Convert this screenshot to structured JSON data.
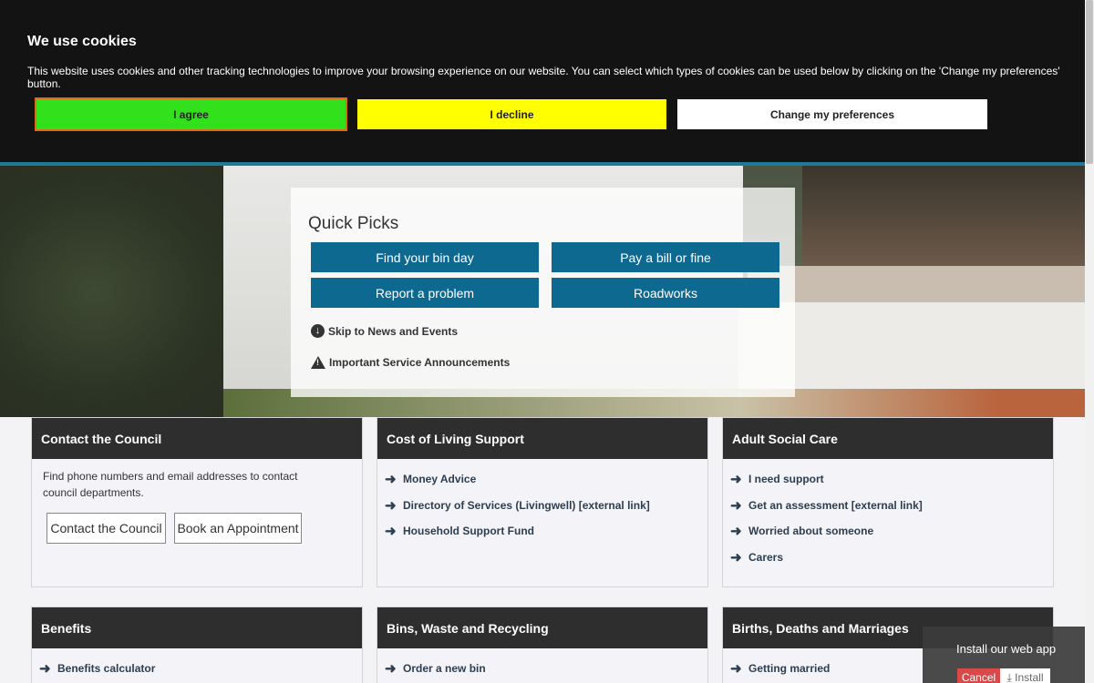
{
  "cookie": {
    "title": "We use cookies",
    "text": "This website uses cookies and other tracking technologies to improve your browsing experience on our website. You can select which types of cookies can be used below by clicking on the 'Change my preferences' button.",
    "agree": "I agree",
    "decline": "I decline",
    "prefs": "Change my preferences"
  },
  "quick_picks": {
    "title": "Quick Picks",
    "buttons": [
      "Find your bin day",
      "Pay a bill or fine",
      "Report a problem",
      "Roadworks"
    ],
    "skip_link": "Skip to News and Events",
    "announce_link": "Important Service Announcements"
  },
  "cards": [
    {
      "title": "Contact the Council",
      "text": "Find phone numbers and email addresses to contact council departments.",
      "buttons": [
        "Contact the Council",
        "Book an Appointment"
      ]
    },
    {
      "title": "Cost of Living Support",
      "links": [
        "Money Advice",
        "Directory of Services (Livingwell) [external link]",
        "Household Support Fund"
      ]
    },
    {
      "title": "Adult Social Care",
      "links": [
        "I need support",
        "Get an assessment [external link]",
        "Worried about someone",
        "Carers"
      ]
    },
    {
      "title": "Benefits",
      "links": [
        "Benefits calculator"
      ]
    },
    {
      "title": "Bins, Waste and Recycling",
      "links": [
        "Order a new bin"
      ]
    },
    {
      "title": "Births, Deaths and Marriages",
      "links": [
        "Getting married"
      ]
    }
  ],
  "install": {
    "text": "Install our web app",
    "cancel": "Cancel",
    "install": "Install"
  },
  "icons": {
    "arrow": "arrow-right-icon",
    "skip": "arrow-down-circle-icon",
    "announce": "warning-icon",
    "download": "download-icon"
  },
  "colors": {
    "banner_bg": "#131314",
    "agree": "#33e01c",
    "decline": "#ffff00",
    "quick_btn": "#0e6991",
    "card_head": "#2e2e2e",
    "cancel": "#d84a4a"
  }
}
